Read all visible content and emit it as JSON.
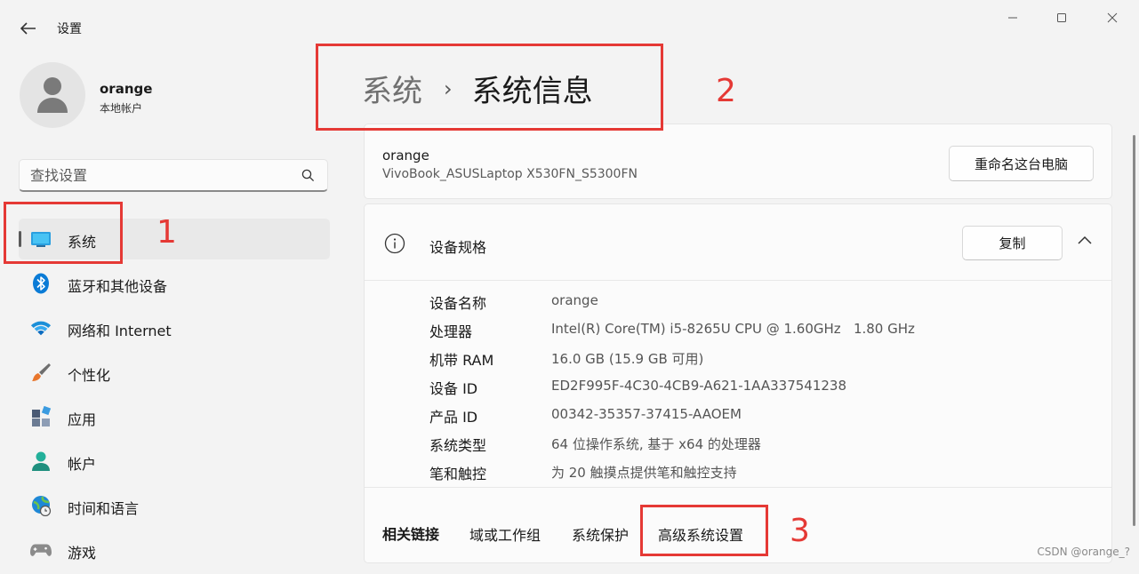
{
  "app": {
    "title": "设置"
  },
  "profile": {
    "name": "orange",
    "account_type": "本地帐户"
  },
  "search": {
    "placeholder": "查找设置"
  },
  "nav": {
    "items": [
      {
        "label": "系统",
        "icon": "monitor-icon",
        "active": true
      },
      {
        "label": "蓝牙和其他设备",
        "icon": "bluetooth-icon"
      },
      {
        "label": "网络和 Internet",
        "icon": "wifi-icon"
      },
      {
        "label": "个性化",
        "icon": "paintbrush-icon"
      },
      {
        "label": "应用",
        "icon": "apps-icon"
      },
      {
        "label": "帐户",
        "icon": "person-icon"
      },
      {
        "label": "时间和语言",
        "icon": "globe-clock-icon"
      },
      {
        "label": "游戏",
        "icon": "gamepad-icon"
      }
    ]
  },
  "breadcrumb": {
    "parent": "系统",
    "separator": "›",
    "current": "系统信息"
  },
  "device": {
    "name": "orange",
    "model": "VivoBook_ASUSLaptop X530FN_S5300FN",
    "rename_label": "重命名这台电脑"
  },
  "specs": {
    "title": "设备规格",
    "copy_label": "复制",
    "rows": [
      {
        "key": "设备名称",
        "value": "orange"
      },
      {
        "key": "处理器",
        "value": "Intel(R) Core(TM) i5-8265U CPU @ 1.60GHz   1.80 GHz"
      },
      {
        "key": "机带 RAM",
        "value": "16.0 GB (15.9 GB 可用)"
      },
      {
        "key": "设备 ID",
        "value": "ED2F995F-4C30-4CB9-A621-1AA337541238"
      },
      {
        "key": "产品 ID",
        "value": "00342-35357-37415-AAOEM"
      },
      {
        "key": "系统类型",
        "value": "64 位操作系统, 基于 x64 的处理器"
      },
      {
        "key": "笔和触控",
        "value": "为 20 触摸点提供笔和触控支持"
      }
    ]
  },
  "related": {
    "label": "相关链接",
    "links": [
      "域或工作组",
      "系统保护",
      "高级系统设置"
    ]
  },
  "annotations": {
    "n1": "1",
    "n2": "2",
    "n3": "3",
    "color": "#e53935"
  },
  "watermark": "CSDN @orange_?"
}
